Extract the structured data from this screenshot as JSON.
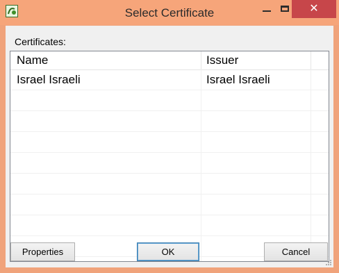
{
  "window": {
    "title": "Select Certificate",
    "icon": "app-logo-icon",
    "frame_color": "#f0a37b",
    "close_color": "#c7464a"
  },
  "list": {
    "label": "Certificates:",
    "columns": [
      "Name",
      "Issuer"
    ],
    "rows": [
      {
        "name": "Israel Israeli",
        "issuer": "Israel Israeli"
      }
    ]
  },
  "buttons": {
    "properties": "Properties",
    "ok": "OK",
    "cancel": "Cancel"
  }
}
